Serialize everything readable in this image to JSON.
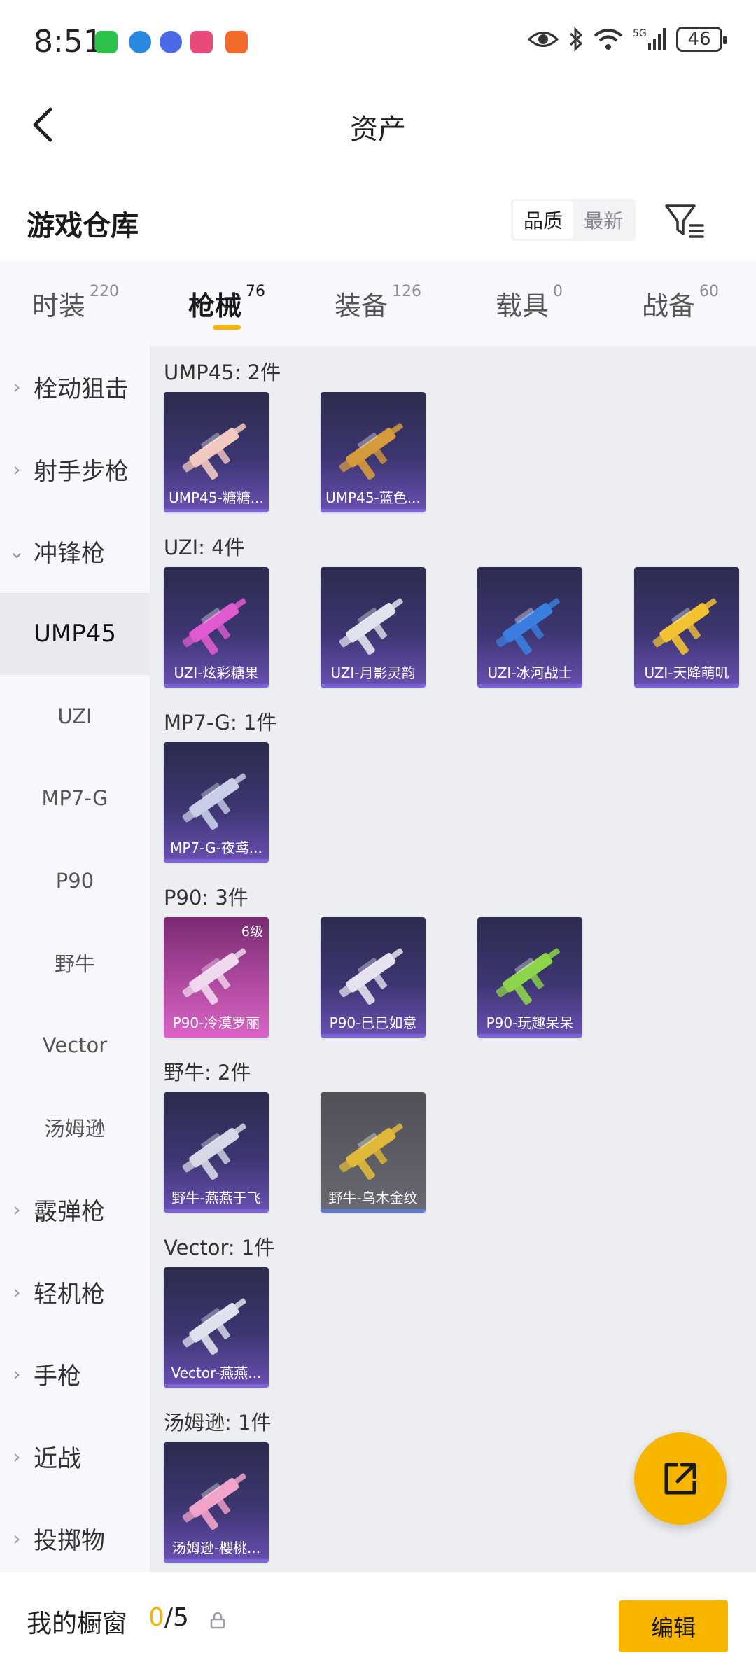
{
  "status": {
    "time": "8:51",
    "battery": "46",
    "network": "5G"
  },
  "nav": {
    "title": "资产"
  },
  "header": {
    "title": "游戏仓库",
    "sort_options": [
      "品质",
      "最新"
    ],
    "sort_selected": "品质"
  },
  "tabs": [
    {
      "label": "时装",
      "count": "220"
    },
    {
      "label": "枪械",
      "count": "76",
      "active": true
    },
    {
      "label": "装备",
      "count": "126"
    },
    {
      "label": "载具",
      "count": "0"
    },
    {
      "label": "战备",
      "count": "60"
    }
  ],
  "sidebar": [
    {
      "label": "栓动狙击",
      "type": "category"
    },
    {
      "label": "射手步枪",
      "type": "category"
    },
    {
      "label": "冲锋枪",
      "type": "category-open"
    },
    {
      "label": "UMP45",
      "type": "selected"
    },
    {
      "label": "UZI",
      "type": "sub"
    },
    {
      "label": "MP7-G",
      "type": "sub"
    },
    {
      "label": "P90",
      "type": "sub"
    },
    {
      "label": "野牛",
      "type": "sub"
    },
    {
      "label": "Vector",
      "type": "sub"
    },
    {
      "label": "汤姆逊",
      "type": "sub"
    },
    {
      "label": "霰弹枪",
      "type": "category"
    },
    {
      "label": "轻机枪",
      "type": "category"
    },
    {
      "label": "手枪",
      "type": "category"
    },
    {
      "label": "近战",
      "type": "category"
    },
    {
      "label": "投掷物",
      "type": "category"
    }
  ],
  "groups": [
    {
      "title": "UMP45: 2件",
      "items": [
        {
          "name": "UMP45-糖糖...",
          "style": "purple",
          "gun_color": "#f2c9c0"
        },
        {
          "name": "UMP45-蓝色...",
          "style": "purple",
          "gun_color": "#d59a3c"
        }
      ]
    },
    {
      "title": "UZI: 4件",
      "items": [
        {
          "name": "UZI-炫彩糖果",
          "style": "purple",
          "gun_color": "#e05bd0"
        },
        {
          "name": "UZI-月影灵韵",
          "style": "purple",
          "gun_color": "#dfe3ee"
        },
        {
          "name": "UZI-冰河战士",
          "style": "purple",
          "gun_color": "#3a7fe0"
        },
        {
          "name": "UZI-天降萌叽",
          "style": "purple",
          "gun_color": "#f2c232"
        }
      ]
    },
    {
      "title": "MP7-G: 1件",
      "items": [
        {
          "name": "MP7-G-夜鸢...",
          "style": "purple",
          "gun_color": "#c9cde8"
        }
      ]
    },
    {
      "title": "P90: 3件",
      "items": [
        {
          "name": "P90-冷漠罗丽",
          "style": "pink",
          "gun_color": "#f0d8ee",
          "level": "6级"
        },
        {
          "name": "P90-巳巳如意",
          "style": "purple",
          "gun_color": "#e6e2ef"
        },
        {
          "name": "P90-玩趣呆呆",
          "style": "purple",
          "gun_color": "#8cd44a"
        }
      ]
    },
    {
      "title": "野牛: 2件",
      "items": [
        {
          "name": "野牛-燕燕于飞",
          "style": "purple",
          "gun_color": "#d6d8e6"
        },
        {
          "name": "野牛-乌木金纹",
          "style": "grey",
          "gun_color": "#e0b93a"
        }
      ]
    },
    {
      "title": "Vector: 1件",
      "items": [
        {
          "name": "Vector-燕燕...",
          "style": "purple",
          "gun_color": "#dfe2ee"
        }
      ]
    },
    {
      "title": "汤姆逊: 1件",
      "items": [
        {
          "name": "汤姆逊-樱桃...",
          "style": "purple",
          "gun_color": "#f2a3c8"
        }
      ]
    }
  ],
  "bottom": {
    "showcase_label": "我的橱窗",
    "showcase_current": "0",
    "showcase_total": "/5",
    "edit_label": "编辑"
  },
  "colors": {
    "accent": "#f7b500",
    "card_purple": "#3d3672",
    "sidebar_bg": "#f6f8fb",
    "content_bg": "#eceef2"
  }
}
